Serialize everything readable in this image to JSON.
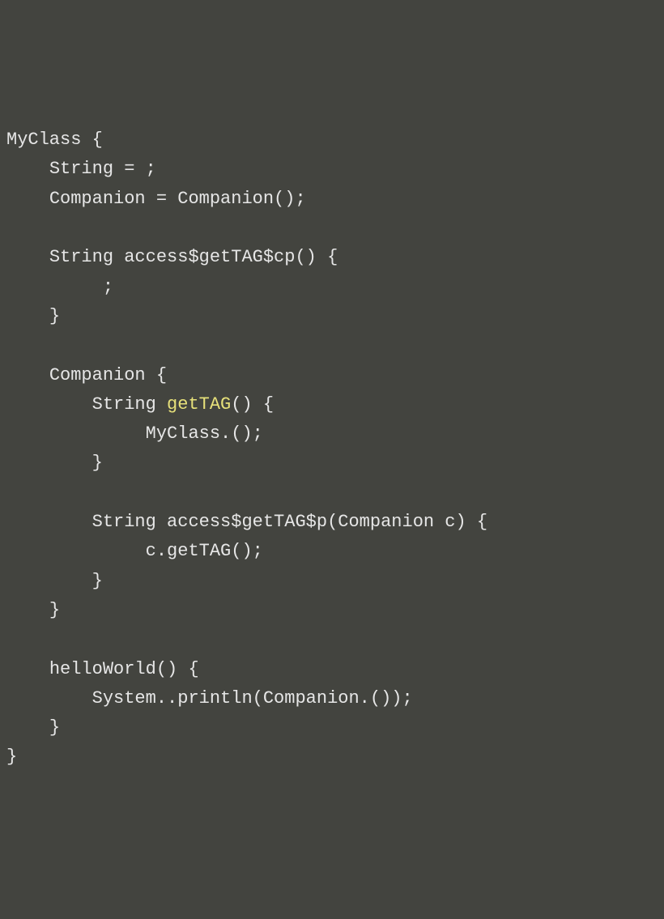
{
  "code": {
    "lines": [
      {
        "indent": 0,
        "segments": [
          {
            "text": "MyClass {",
            "class": "tok"
          }
        ]
      },
      {
        "indent": 1,
        "segments": [
          {
            "text": "String = ;",
            "class": "tok"
          }
        ]
      },
      {
        "indent": 1,
        "segments": [
          {
            "text": "Companion = Companion();",
            "class": "tok"
          }
        ]
      },
      {
        "indent": 0,
        "segments": [
          {
            "text": "",
            "class": "tok"
          }
        ]
      },
      {
        "indent": 1,
        "segments": [
          {
            "text": "String access$getTAG$cp() {",
            "class": "tok"
          }
        ]
      },
      {
        "indent": 2,
        "segments": [
          {
            "text": " ;",
            "class": "tok"
          }
        ]
      },
      {
        "indent": 1,
        "segments": [
          {
            "text": "}",
            "class": "tok"
          }
        ]
      },
      {
        "indent": 0,
        "segments": [
          {
            "text": "",
            "class": "tok"
          }
        ]
      },
      {
        "indent": 1,
        "segments": [
          {
            "text": "Companion {",
            "class": "tok"
          }
        ]
      },
      {
        "indent": 2,
        "segments": [
          {
            "text": "String ",
            "class": "tok"
          },
          {
            "text": "getTAG",
            "class": "highlight"
          },
          {
            "text": "() {",
            "class": "tok"
          }
        ]
      },
      {
        "indent": 3,
        "segments": [
          {
            "text": " MyClass.();",
            "class": "tok"
          }
        ]
      },
      {
        "indent": 2,
        "segments": [
          {
            "text": "}",
            "class": "tok"
          }
        ]
      },
      {
        "indent": 0,
        "segments": [
          {
            "text": "",
            "class": "tok"
          }
        ]
      },
      {
        "indent": 2,
        "segments": [
          {
            "text": "String access$getTAG$p(Companion c) {",
            "class": "tok"
          }
        ]
      },
      {
        "indent": 3,
        "segments": [
          {
            "text": " c.getTAG();",
            "class": "tok"
          }
        ]
      },
      {
        "indent": 2,
        "segments": [
          {
            "text": "}",
            "class": "tok"
          }
        ]
      },
      {
        "indent": 1,
        "segments": [
          {
            "text": "}",
            "class": "tok"
          }
        ]
      },
      {
        "indent": 0,
        "segments": [
          {
            "text": "",
            "class": "tok"
          }
        ]
      },
      {
        "indent": 1,
        "segments": [
          {
            "text": "helloWorld() {",
            "class": "tok"
          }
        ]
      },
      {
        "indent": 2,
        "segments": [
          {
            "text": "System..println(Companion.());",
            "class": "tok"
          }
        ]
      },
      {
        "indent": 1,
        "segments": [
          {
            "text": "}",
            "class": "tok"
          }
        ]
      },
      {
        "indent": 0,
        "segments": [
          {
            "text": "}",
            "class": "tok"
          }
        ]
      }
    ],
    "indentUnit": "    "
  }
}
